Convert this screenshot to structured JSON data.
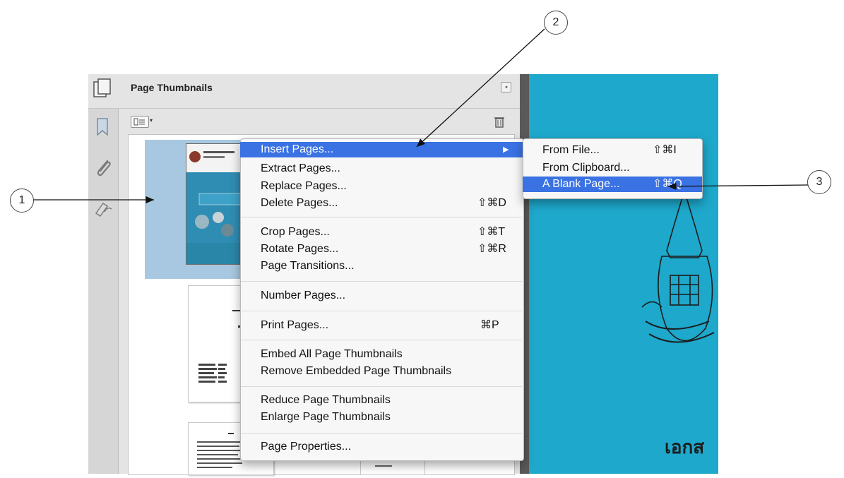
{
  "panel": {
    "title": "Page Thumbnails",
    "collapse_glyph": "◂",
    "options_icon": "options-icon",
    "caret": "▾",
    "trash_icon": "trash-icon"
  },
  "nav_icons": [
    "bookmark-icon",
    "attachment-icon",
    "signature-icon"
  ],
  "menu": {
    "groups": [
      [
        {
          "label": "Insert Pages...",
          "shortcut": "",
          "submenu": true,
          "highlighted": true
        },
        {
          "label": "Extract Pages...",
          "shortcut": ""
        },
        {
          "label": "Replace Pages...",
          "shortcut": ""
        },
        {
          "label": "Delete Pages...",
          "shortcut": "⇧⌘D"
        }
      ],
      [
        {
          "label": "Crop Pages...",
          "shortcut": "⇧⌘T"
        },
        {
          "label": "Rotate Pages...",
          "shortcut": "⇧⌘R"
        },
        {
          "label": "Page Transitions...",
          "shortcut": ""
        }
      ],
      [
        {
          "label": "Number Pages...",
          "shortcut": ""
        }
      ],
      [
        {
          "label": "Print Pages...",
          "shortcut": "⌘P"
        }
      ],
      [
        {
          "label": "Embed All Page Thumbnails",
          "shortcut": ""
        },
        {
          "label": "Remove Embedded Page Thumbnails",
          "shortcut": ""
        }
      ],
      [
        {
          "label": "Reduce Page Thumbnails",
          "shortcut": ""
        },
        {
          "label": "Enlarge Page Thumbnails",
          "shortcut": ""
        }
      ],
      [
        {
          "label": "Page Properties...",
          "shortcut": ""
        }
      ]
    ],
    "submenu_arrow": "▶"
  },
  "submenu": {
    "items": [
      {
        "label": "From File...",
        "shortcut": "⇧⌘I"
      },
      {
        "label": "From Clipboard...",
        "shortcut": ""
      },
      {
        "label": "A Blank Page...",
        "shortcut": "⇧⌘Q",
        "highlighted": true
      }
    ]
  },
  "document": {
    "text": "เอกส",
    "background": "#1ea8cb"
  },
  "callouts": [
    "1",
    "2",
    "3"
  ],
  "colors": {
    "highlight": "#3a72e3",
    "selection": "#a7c8e0"
  }
}
